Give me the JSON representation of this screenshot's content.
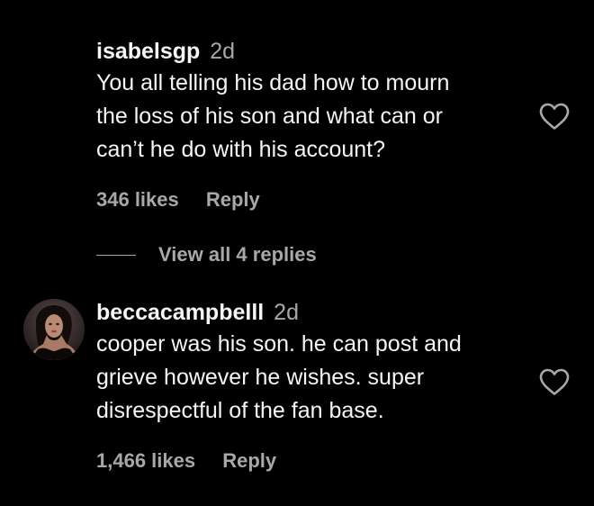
{
  "comments": [
    {
      "username": "isabelsgp",
      "time": "2d",
      "text": "You all telling his dad how to mourn\nthe loss of his son and what can or\ncan’t he do with his account?",
      "likes": "346 likes",
      "reply_label": "Reply",
      "has_avatar": false,
      "icon": "heart-outline-icon"
    },
    {
      "username": "beccacampbelll",
      "time": "2d",
      "text": "cooper was his son. he can post and\ngrieve however he wishes. super\ndisrespectful of the fan base.",
      "likes": "1,466 likes",
      "reply_label": "Reply",
      "has_avatar": true,
      "icon": "heart-outline-icon"
    }
  ],
  "view_replies": {
    "label": "View all 4 replies"
  },
  "colors": {
    "background": "#000000",
    "primary_text": "#f5f5f5",
    "secondary_text": "#a8a8a8"
  }
}
